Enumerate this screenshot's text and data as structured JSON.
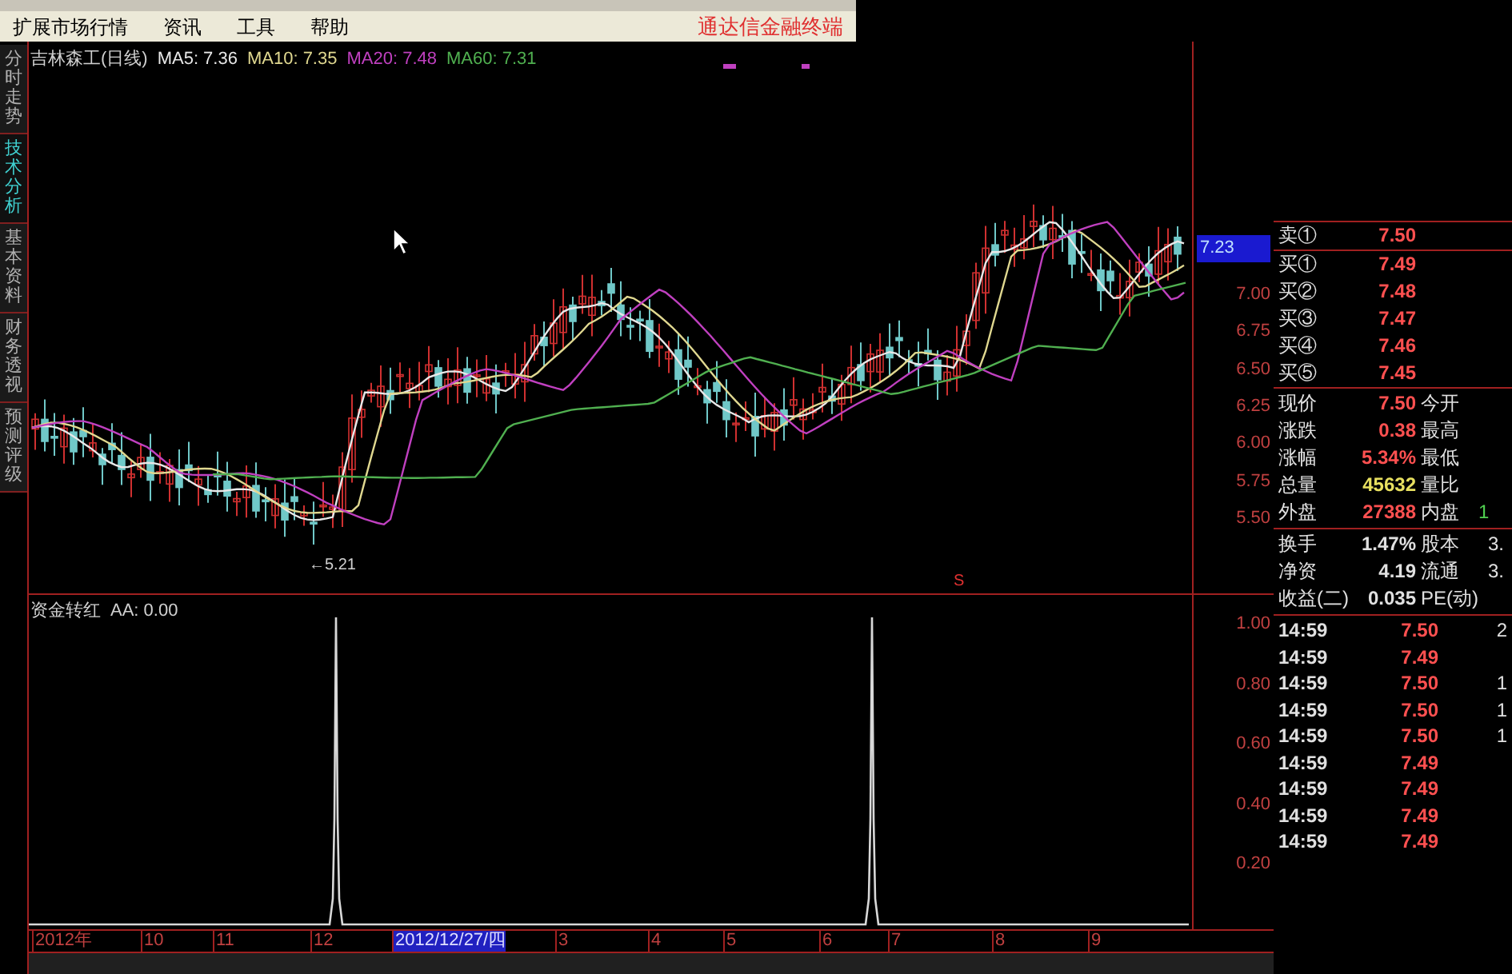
{
  "menu_bar": {
    "items": [
      "扩展市场行情",
      "资讯",
      "工具",
      "帮助"
    ],
    "brand": "通达信金融终端"
  },
  "side_tabs": [
    {
      "label": "分时走势",
      "selected": false
    },
    {
      "label": "技术分析",
      "selected": true
    },
    {
      "label": "基本资料",
      "selected": false
    },
    {
      "label": "财务透视",
      "selected": false
    },
    {
      "label": "预测评级",
      "selected": false
    }
  ],
  "price_chart": {
    "title": "吉林森工(日线)",
    "ma": [
      {
        "label": "MA5: 7.36",
        "color": "#e8e8e8"
      },
      {
        "label": "MA10: 7.35",
        "color": "#e0d890"
      },
      {
        "label": "MA20: 7.48",
        "color": "#c040c0"
      },
      {
        "label": "MA60: 7.31",
        "color": "#50b050"
      }
    ],
    "low_marker": "←5.21",
    "signal_marker": "S",
    "current_price_tag": "7.23",
    "y_axis": [
      "7.00",
      "6.75",
      "6.50",
      "6.25",
      "6.00",
      "5.75",
      "5.50"
    ]
  },
  "indicator": {
    "title": "资金转红",
    "value": "AA: 0.00",
    "y_axis": [
      "1.00",
      "0.80",
      "0.60",
      "0.40",
      "0.20"
    ]
  },
  "time_axis": [
    {
      "label": "2012年",
      "selected": false
    },
    {
      "label": "10",
      "selected": false
    },
    {
      "label": "11",
      "selected": false
    },
    {
      "label": "12",
      "selected": false
    },
    {
      "label": "2012/12/27/四",
      "selected": true
    },
    {
      "label": "3",
      "selected": false
    },
    {
      "label": "4",
      "selected": false
    },
    {
      "label": "5",
      "selected": false
    },
    {
      "label": "6",
      "selected": false
    },
    {
      "label": "7",
      "selected": false
    },
    {
      "label": "8",
      "selected": false
    },
    {
      "label": "9",
      "selected": false
    }
  ],
  "quote": {
    "order_book": [
      {
        "label": "卖①",
        "price": "7.50"
      },
      {
        "label": "买①",
        "price": "7.49"
      },
      {
        "label": "买②",
        "price": "7.48"
      },
      {
        "label": "买③",
        "price": "7.47"
      },
      {
        "label": "买④",
        "price": "7.46"
      },
      {
        "label": "买⑤",
        "price": "7.45"
      }
    ],
    "stats": [
      {
        "label": "现价",
        "value": "7.50",
        "color": "#ff5050",
        "label_2": "今开"
      },
      {
        "label": "涨跌",
        "value": "0.38",
        "color": "#ff5050",
        "label_2": "最高"
      },
      {
        "label": "涨幅",
        "value": "5.34%",
        "color": "#ff5050",
        "label_2": "最低"
      },
      {
        "label": "总量",
        "value": "45632",
        "color": "#e8e060",
        "label_2": "量比"
      },
      {
        "label": "外盘",
        "value": "27388",
        "color": "#ff5050",
        "label_2": "内盘",
        "value_2": "1"
      }
    ],
    "finance": [
      {
        "label": "换手",
        "value": "1.47%",
        "label_2": "股本",
        "value_2": "3."
      },
      {
        "label": "净资",
        "value": "4.19",
        "label_2": "流通",
        "value_2": "3."
      },
      {
        "label": "收益(二)",
        "value": "0.035",
        "label_2": "PE(动)"
      }
    ],
    "trades": [
      {
        "time": "14:59",
        "price": "7.50",
        "column_3": "2"
      },
      {
        "time": "14:59",
        "price": "7.49"
      },
      {
        "time": "14:59",
        "price": "7.50",
        "column_3": "1"
      },
      {
        "time": "14:59",
        "price": "7.50",
        "column_3": "1"
      },
      {
        "time": "14:59",
        "price": "7.50",
        "column_3": "1"
      },
      {
        "time": "14:59",
        "price": "7.49"
      },
      {
        "time": "14:59",
        "price": "7.49"
      },
      {
        "time": "14:59",
        "price": "7.49"
      },
      {
        "time": "14:59",
        "price": "7.49"
      }
    ]
  }
}
